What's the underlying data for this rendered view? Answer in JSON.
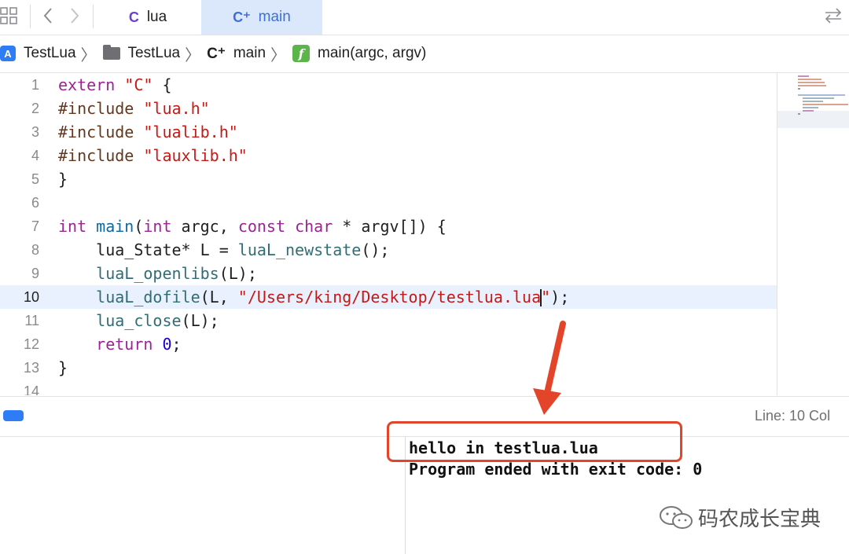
{
  "tabs": [
    {
      "icon": "C",
      "label": "lua",
      "active": false
    },
    {
      "icon": "C⁺",
      "label": "main",
      "active": true
    }
  ],
  "breadcrumb": [
    {
      "icon": "app-icon",
      "label": "TestLua"
    },
    {
      "icon": "folder-icon",
      "label": "TestLua"
    },
    {
      "icon": "C⁺",
      "label": "main"
    },
    {
      "icon": "function-icon",
      "label": "main(argc, argv)"
    }
  ],
  "editor": {
    "current_line": 10,
    "lines": [
      {
        "n": "1"
      },
      {
        "n": "2"
      },
      {
        "n": "3"
      },
      {
        "n": "4"
      },
      {
        "n": "5"
      },
      {
        "n": "6"
      },
      {
        "n": "7"
      },
      {
        "n": "8"
      },
      {
        "n": "9"
      },
      {
        "n": "10"
      },
      {
        "n": "11"
      },
      {
        "n": "12"
      },
      {
        "n": "13"
      },
      {
        "n": "14"
      }
    ]
  },
  "code": {
    "l1_kw": "extern",
    "l1_str": "\"C\"",
    "l1_rest": " {",
    "l2_pre": "#include ",
    "l2_str": "\"lua.h\"",
    "l3_pre": "#include ",
    "l3_str": "\"lualib.h\"",
    "l4_pre": "#include ",
    "l4_str": "\"lauxlib.h\"",
    "l5": "}",
    "l7_kw1": "int",
    "l7_fn": "main",
    "l7_a": "(",
    "l7_kw2": "int",
    "l7_b": " argc, ",
    "l7_kw3": "const",
    "l7_kw4": "char",
    "l7_c": " * argv[]) {",
    "l8_a": "    lua_State* L = ",
    "l8_fn": "luaL_newstate",
    "l8_b": "();",
    "l9_a": "    ",
    "l9_fn": "luaL_openlibs",
    "l9_b": "(L);",
    "l10_a": "    ",
    "l10_fn": "luaL_dofile",
    "l10_b": "(L, ",
    "l10_str1": "\"/Users/king/Desktop/testlua.lua",
    "l10_str2": "\"",
    "l10_c": ");",
    "l11_a": "    ",
    "l11_fn": "lua_close",
    "l11_b": "(L);",
    "l12_a": "    ",
    "l12_kw": "return",
    "l12_sp": " ",
    "l12_num": "0",
    "l12_b": ";",
    "l13": "}"
  },
  "status": {
    "line_info": "Line: 10  Col"
  },
  "console": {
    "line1": "hello in testlua.lua",
    "line2": "Program ended with exit code: 0"
  },
  "watermark": {
    "text": "码农成长宝典"
  },
  "colors": {
    "accent": "#2f7df6",
    "highlight_box": "#e3452a",
    "arrow": "#e3452a",
    "active_tab_bg": "#dbe8fb"
  }
}
